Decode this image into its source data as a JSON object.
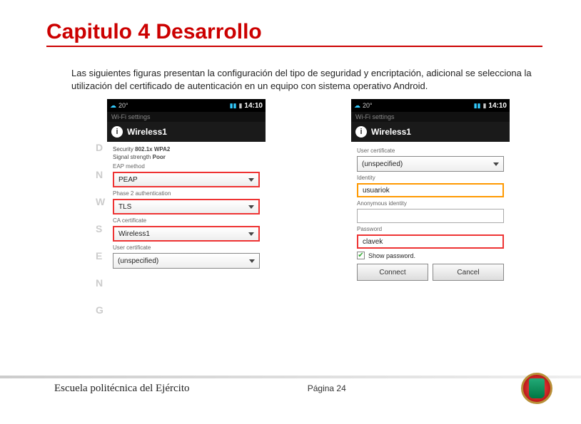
{
  "title": "Capitulo 4  Desarrollo",
  "body": "Las siguientes figuras presentan la configuración del tipo de seguridad y encriptación, adicional se selecciona la utilización del certificado de autenticación en un equipo con sistema operativo Android.",
  "phone1": {
    "temp": "20°",
    "time": "14:10",
    "section": "Wi-Fi settings",
    "network": "Wireless1",
    "security_label": "Security",
    "security_value": "802.1x WPA2",
    "signal_label": "Signal strength",
    "signal_value": "Poor",
    "eap_label": "EAP method",
    "eap_value": "PEAP",
    "phase2_label": "Phase 2 authentication",
    "phase2_value": "TLS",
    "ca_label": "CA certificate",
    "ca_value": "Wireless1",
    "usercert_label": "User certificate",
    "usercert_value": "(unspecified)"
  },
  "phone2": {
    "temp": "20°",
    "time": "14:10",
    "section": "Wi-Fi settings",
    "network": "Wireless1",
    "usercert_label": "User certificate",
    "usercert_value": "(unspecified)",
    "identity_label": "Identity",
    "identity_value": "usuariok",
    "anon_label": "Anonymous identity",
    "anon_value": "",
    "password_label": "Password",
    "password_value": "clavek",
    "showpw_label": "Show password.",
    "connect": "Connect",
    "cancel": "Cancel"
  },
  "footer": {
    "school": "Escuela politécnica del Ejército",
    "page": "Página 24"
  }
}
